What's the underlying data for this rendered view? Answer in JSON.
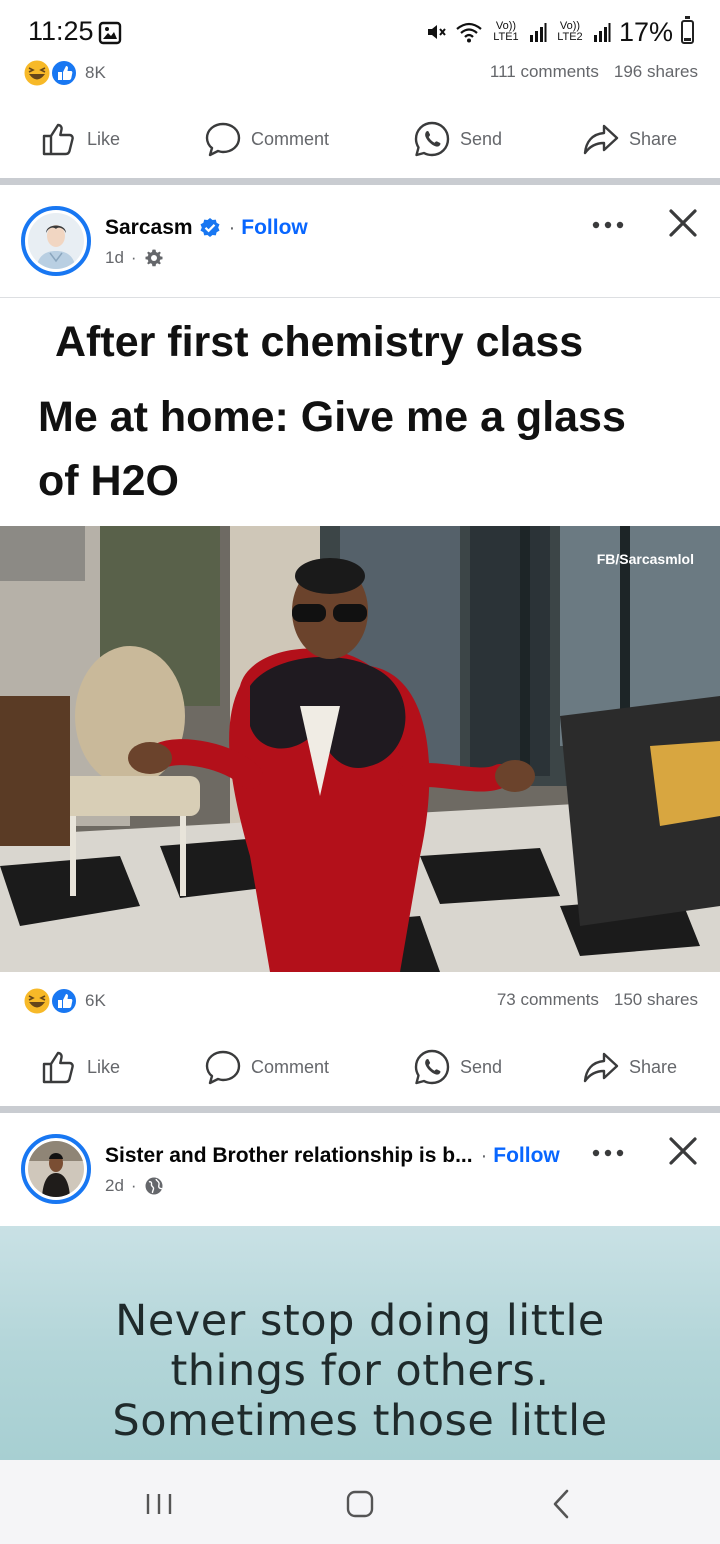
{
  "status_bar": {
    "time": "11:25",
    "battery_percent": "17%",
    "battery_level": 0.17,
    "sim1_label": "Vo)) LTE1",
    "sim2_label": "Vo)) LTE2",
    "icons": [
      "gallery-icon",
      "mute-icon",
      "wifi-icon",
      "signal-icon",
      "battery-icon"
    ]
  },
  "previous_post": {
    "reaction_count": "8K",
    "comments": "111 comments",
    "shares": "196 shares"
  },
  "actions": {
    "like": "Like",
    "comment": "Comment",
    "send": "Send",
    "share": "Share"
  },
  "post1": {
    "author": "Sarcasm",
    "follow": "Follow",
    "separator": "·",
    "time": "1d",
    "audience_icon": "gear-icon",
    "meme_lines": [
      "After first chemistry class",
      "Me at home: Give me a glass",
      "of H2O"
    ],
    "watermark": "FB/Sarcasmlol",
    "reaction_count": "6K",
    "comments": "73 comments",
    "shares": "150 shares"
  },
  "post2": {
    "author": "Sister and Brother relationship is b...",
    "follow": "Follow",
    "separator": "·",
    "time": "2d",
    "audience_icon": "globe-icon",
    "quote_lines": [
      "Never stop doing little",
      "things for others.",
      "Sometimes those little"
    ]
  },
  "colors": {
    "facebook_blue": "#0866ff",
    "secondary_text": "#65676b",
    "divider": "#c9ccd1"
  },
  "nav_bar": {
    "icons": [
      "recent-apps-icon",
      "home-icon",
      "back-icon"
    ]
  }
}
